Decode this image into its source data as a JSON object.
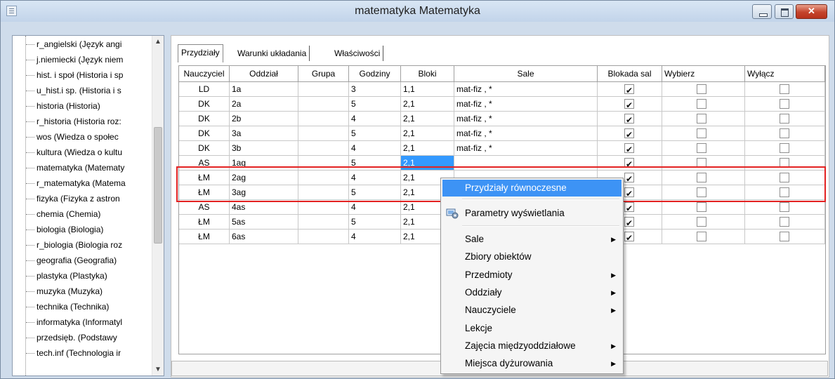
{
  "window": {
    "title": "matematyka Matematyka"
  },
  "tree": {
    "items": [
      "r_angielski (Język angi",
      "j.niemiecki (Język niem",
      "hist. i społ (Historia i sp",
      "u_hist.i sp. (Historia i s",
      "historia (Historia)",
      "r_historia (Historia roz:",
      "wos (Wiedza o społec",
      "kultura (Wiedza o kultu",
      "matematyka (Matematy",
      "r_matematyka (Matema",
      "fizyka (Fizyka z astron",
      "chemia (Chemia)",
      "biologia (Biologia)",
      "r_biologia (Biologia roz",
      "geografia (Geografia)",
      "plastyka (Plastyka)",
      "muzyka (Muzyka)",
      "technika (Technika)",
      "informatyka (Informatyl",
      "przedsięb. (Podstawy",
      "tech.inf (Technologia ir"
    ]
  },
  "tabs": [
    "Przydziały",
    "Warunki układania",
    "Właściwości"
  ],
  "table": {
    "headers": [
      "Nauczyciel",
      "Oddział",
      "Grupa",
      "Godziny",
      "Bloki",
      "Sale",
      "Blokada sal",
      "Wybierz",
      "Wyłącz"
    ],
    "rows": [
      {
        "nauczyciel": "LD",
        "oddzial": "1a",
        "grupa": "",
        "godziny": "3",
        "bloki": "1,1",
        "sale": "mat-fiz , *",
        "blokada": true
      },
      {
        "nauczyciel": "DK",
        "oddzial": "2a",
        "grupa": "",
        "godziny": "5",
        "bloki": "2,1",
        "sale": "mat-fiz , *",
        "blokada": true
      },
      {
        "nauczyciel": "DK",
        "oddzial": "2b",
        "grupa": "",
        "godziny": "4",
        "bloki": "2,1",
        "sale": "mat-fiz , *",
        "blokada": true
      },
      {
        "nauczyciel": "DK",
        "oddzial": "3a",
        "grupa": "",
        "godziny": "5",
        "bloki": "2,1",
        "sale": "mat-fiz , *",
        "blokada": true
      },
      {
        "nauczyciel": "DK",
        "oddzial": "3b",
        "grupa": "",
        "godziny": "4",
        "bloki": "2,1",
        "sale": "mat-fiz , *",
        "blokada": true
      },
      {
        "nauczyciel": "AS",
        "oddzial": "1ag",
        "grupa": "",
        "godziny": "5",
        "bloki": "2,1",
        "sale": "",
        "blokada": true
      },
      {
        "nauczyciel": "ŁM",
        "oddzial": "2ag",
        "grupa": "",
        "godziny": "4",
        "bloki": "2,1",
        "sale": "",
        "blokada": true
      },
      {
        "nauczyciel": "ŁM",
        "oddzial": "3ag",
        "grupa": "",
        "godziny": "5",
        "bloki": "2,1",
        "sale": "",
        "blokada": true
      },
      {
        "nauczyciel": "AS",
        "oddzial": "4as",
        "grupa": "",
        "godziny": "4",
        "bloki": "2,1",
        "sale": "",
        "blokada": true
      },
      {
        "nauczyciel": "ŁM",
        "oddzial": "5as",
        "grupa": "",
        "godziny": "5",
        "bloki": "2,1",
        "sale": "",
        "blokada": true
      },
      {
        "nauczyciel": "ŁM",
        "oddzial": "6as",
        "grupa": "",
        "godziny": "4",
        "bloki": "2,1",
        "sale": "",
        "blokada": true
      }
    ]
  },
  "context_menu": {
    "items": [
      {
        "label": "Przydziały równoczesne",
        "submenu": false,
        "hover": true
      },
      {
        "label": "Parametry wyświetlania",
        "submenu": false,
        "icon": "display-settings-icon"
      },
      {
        "label": "Sale",
        "submenu": true
      },
      {
        "label": "Zbiory obiektów",
        "submenu": false
      },
      {
        "label": "Przedmioty",
        "submenu": true
      },
      {
        "label": "Oddziały",
        "submenu": true
      },
      {
        "label": "Nauczyciele",
        "submenu": true
      },
      {
        "label": "Lekcje",
        "submenu": false
      },
      {
        "label": "Zajęcia międzyoddziałowe",
        "submenu": true
      },
      {
        "label": "Miejsca dyżurowania",
        "submenu": true
      }
    ]
  },
  "colors": {
    "selection": "#3399ff",
    "menu_hover": "#3d93f5",
    "highlight_box": "#e32222"
  }
}
